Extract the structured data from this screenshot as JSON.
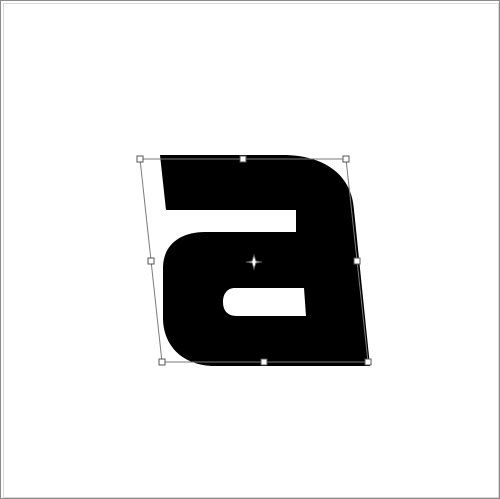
{
  "canvas": {
    "background": "#ffffff",
    "border_color": "#8a8a8a"
  },
  "glyph": {
    "character": "a",
    "fill": "#000000"
  },
  "transform": {
    "mode": "free-transform",
    "handle_fill": "#ffffff",
    "handle_stroke": "#555555",
    "box_stroke": "#7a7a7a",
    "center_marker_icon": "crosshair-icon"
  }
}
